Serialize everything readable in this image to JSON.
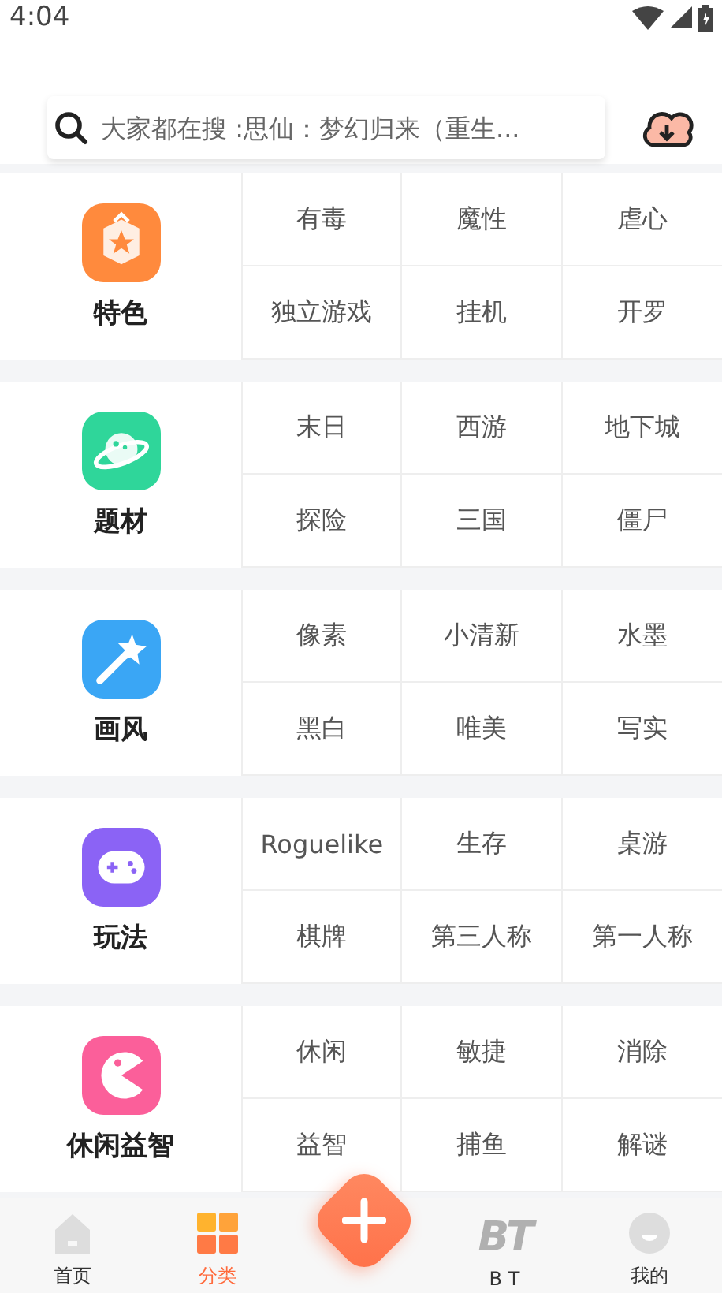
{
  "status_bar": {
    "time": "4:04"
  },
  "search": {
    "placeholder": "大家都在搜 :思仙：梦幻归来（重生..."
  },
  "categories": [
    {
      "name": "特色",
      "color": "#ff8a3d",
      "tags": [
        "有毒",
        "魔性",
        "虐心",
        "独立游戏",
        "挂机",
        "开罗"
      ]
    },
    {
      "name": "题材",
      "color": "#2fd69a",
      "tags": [
        "末日",
        "西游",
        "地下城",
        "探险",
        "三国",
        "僵尸"
      ]
    },
    {
      "name": "画风",
      "color": "#3aa6f5",
      "tags": [
        "像素",
        "小清新",
        "水墨",
        "黑白",
        "唯美",
        "写实"
      ]
    },
    {
      "name": "玩法",
      "color": "#8b63f5",
      "tags": [
        "Roguelike",
        "生存",
        "桌游",
        "棋牌",
        "第三人称",
        "第一人称"
      ]
    },
    {
      "name": "休闲益智",
      "color": "#fb5f9a",
      "tags": [
        "休闲",
        "敏捷",
        "消除",
        "益智",
        "捕鱼",
        "解谜"
      ]
    }
  ],
  "nav": [
    {
      "label": "首页",
      "selected": false
    },
    {
      "label": "分类",
      "selected": true
    },
    {
      "label": "B T",
      "selected": false,
      "icon_text": "BT"
    },
    {
      "label": "我的",
      "selected": false
    }
  ]
}
